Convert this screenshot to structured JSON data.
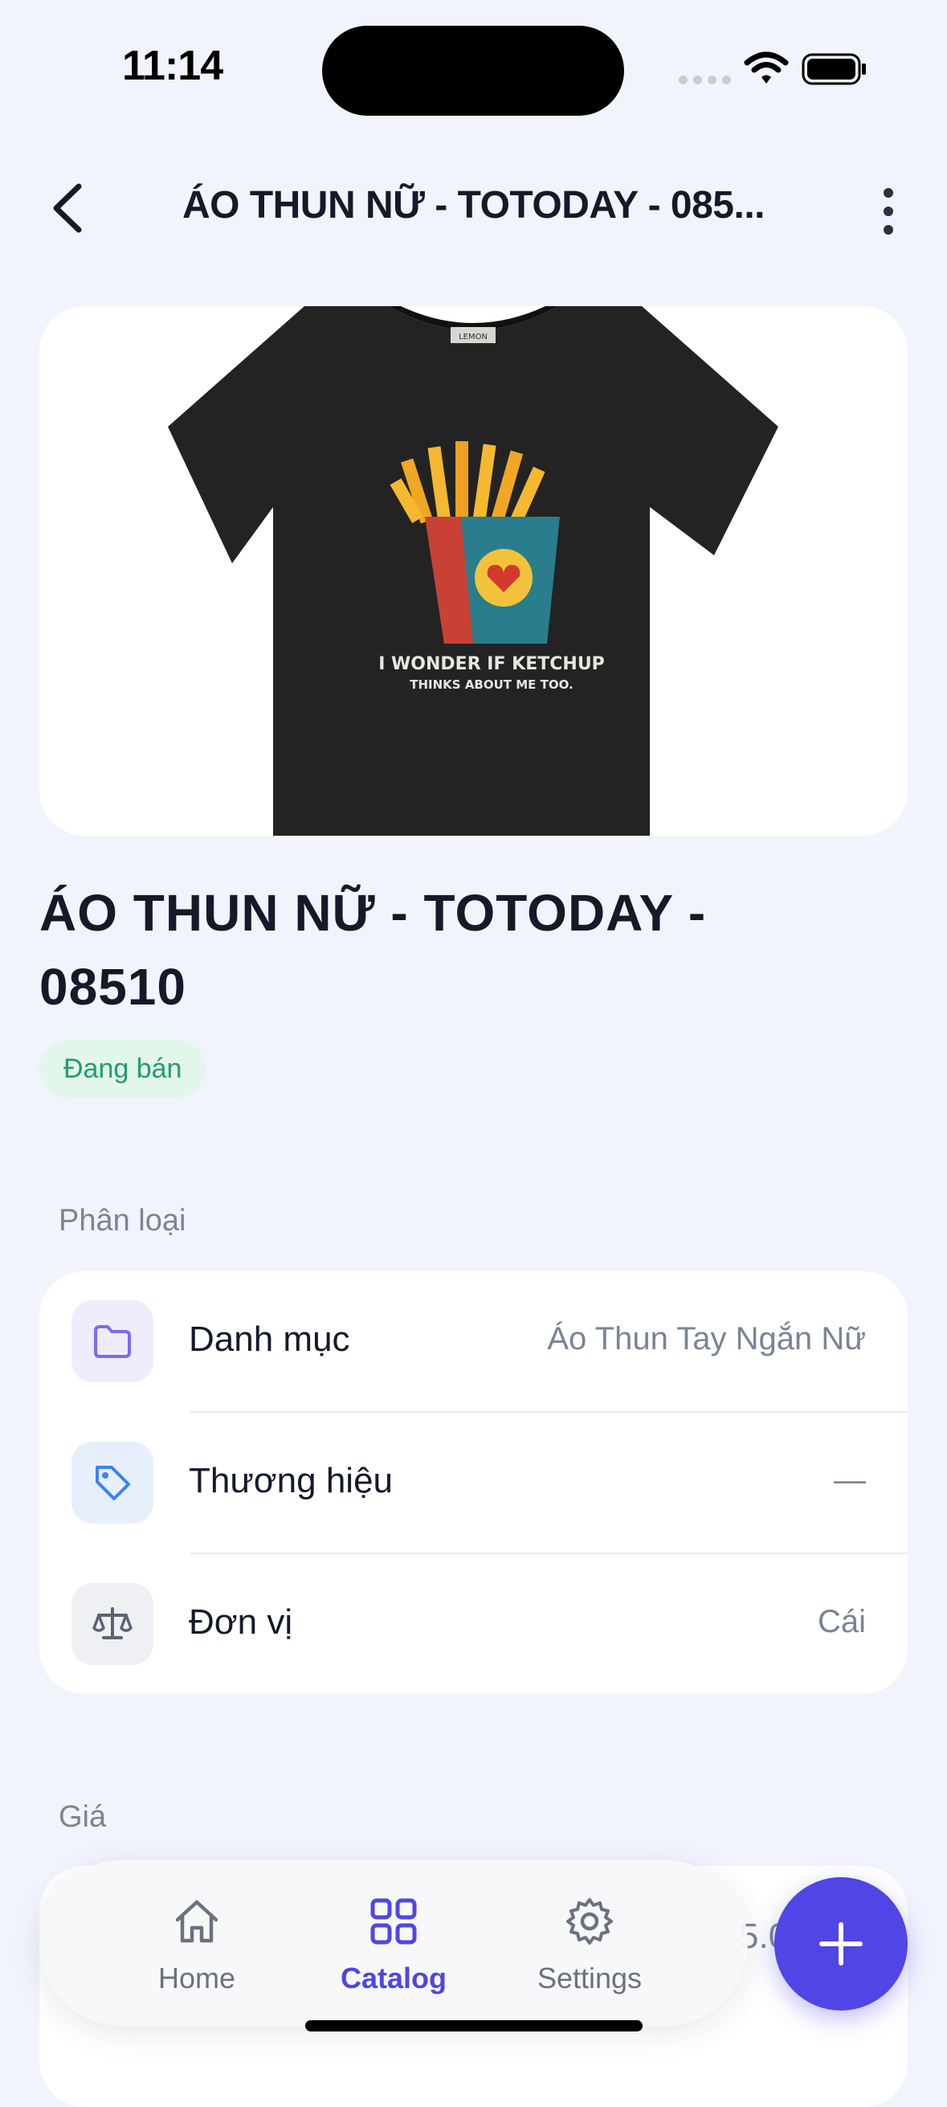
{
  "status_bar": {
    "time": "11:14"
  },
  "header": {
    "title": "ÁO THUN NỮ - TOTODAY - 085..."
  },
  "product": {
    "title": "ÁO THUN NỮ - TOTODAY - 08510",
    "status": "Đang bán",
    "image": {
      "tag_text": "LEMON",
      "print_line1": "I WONDER IF KETCHUP",
      "print_line2": "THINKS ABOUT ME TOO."
    }
  },
  "classification": {
    "label": "Phân loại",
    "rows": [
      {
        "icon": "folder-icon",
        "label": "Danh mục",
        "value": "Áo Thun Tay Ngắn Nữ",
        "icon_bg": "#efedfd",
        "icon_color": "#7c6cf0"
      },
      {
        "icon": "tag-icon",
        "label": "Thương hiệu",
        "value": "—",
        "icon_bg": "#e7effd",
        "icon_color": "#3b82f6"
      },
      {
        "icon": "scale-icon",
        "label": "Đơn vị",
        "value": "Cái",
        "icon_bg": "#eef0f4",
        "icon_color": "#5b6475"
      }
    ]
  },
  "price": {
    "label": "Giá",
    "partial_value": "5.0"
  },
  "tabs": [
    {
      "icon": "home-icon",
      "label": "Home",
      "active": false
    },
    {
      "icon": "grid-icon",
      "label": "Catalog",
      "active": true
    },
    {
      "icon": "gear-icon",
      "label": "Settings",
      "active": false
    }
  ],
  "colors": {
    "accent": "#4f46e5",
    "background": "#f1f4fd",
    "success": "#1fa067"
  }
}
